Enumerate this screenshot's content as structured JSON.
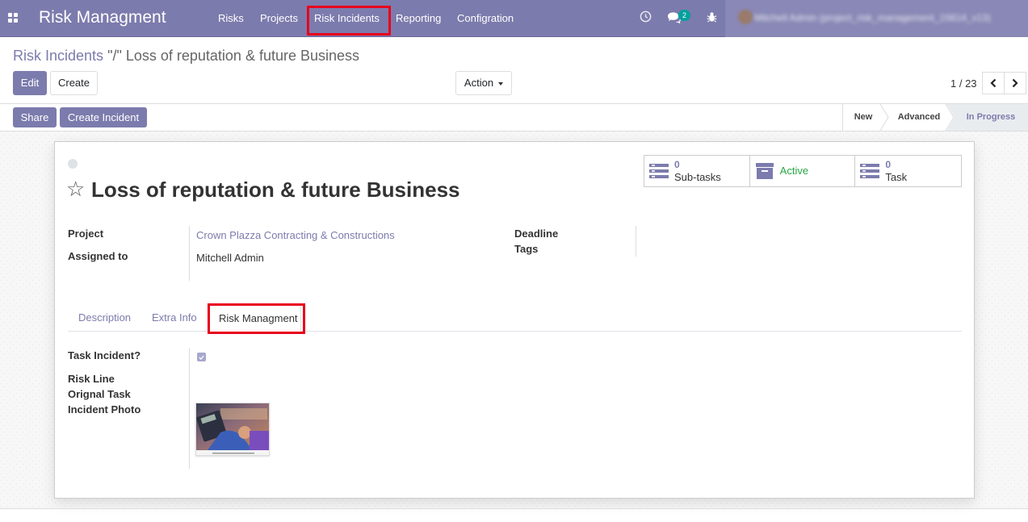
{
  "navbar": {
    "app_title": "Risk Managment",
    "menu": [
      "Risks",
      "Projects",
      "Risk Incidents",
      "Reporting",
      "Configration"
    ],
    "message_count": "2",
    "user_label": "Mitchell Admin (project_risk_management_15614_v13)"
  },
  "breadcrumb": {
    "parent": "Risk Incidents",
    "current": "\"/\" Loss of reputation & future Business"
  },
  "toolbar": {
    "edit": "Edit",
    "create": "Create",
    "action": "Action",
    "pager": "1 / 23"
  },
  "header_buttons": {
    "share": "Share",
    "create_incident": "Create Incident"
  },
  "stages": [
    "New",
    "Advanced",
    "In Progress"
  ],
  "record": {
    "title": "Loss of reputation & future Business",
    "smart_buttons": {
      "subtasks_count": "0",
      "subtasks_label": "Sub-tasks",
      "active_label": "Active",
      "task_count": "0",
      "task_label": "Task"
    },
    "fields": {
      "project_label": "Project",
      "project_value": "Crown Plazza Contracting & Constructions",
      "assigned_label": "Assigned to",
      "assigned_value": "Mitchell Admin",
      "deadline_label": "Deadline",
      "tags_label": "Tags"
    },
    "tabs": [
      "Description",
      "Extra Info",
      "Risk Managment"
    ],
    "risk_tab": {
      "task_incident_label": "Task Incident?",
      "task_incident_checked": true,
      "risk_line_label": "Risk Line",
      "original_task_label": "Orignal Task",
      "incident_photo_label": "Incident Photo"
    }
  },
  "colors": {
    "brand": "#7c7bad",
    "highlight": "#e8001c",
    "active_green": "#28a745",
    "badge": "#00a09d"
  }
}
